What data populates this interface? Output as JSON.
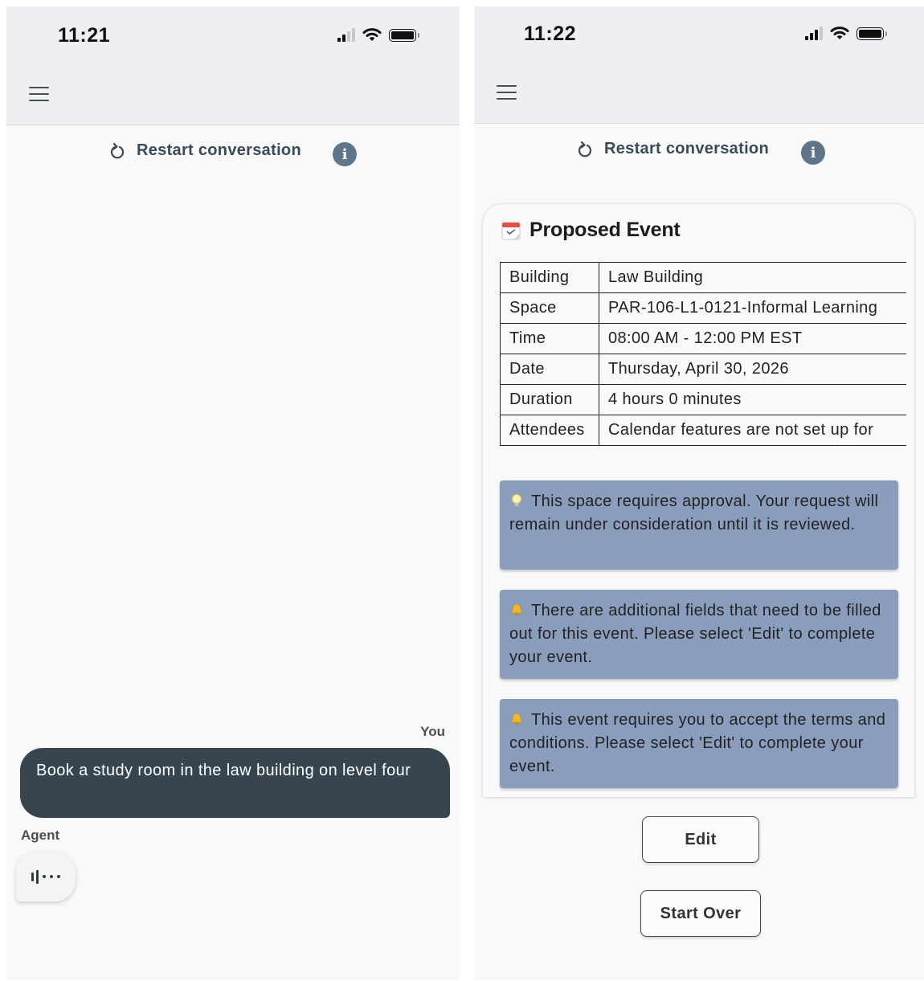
{
  "left_screen": {
    "status_bar": {
      "time": "11:21"
    },
    "restart_label": "Restart conversation",
    "info_glyph": "i",
    "messages": {
      "user_label": "You",
      "user_message": "Book a study room in the law building on level four",
      "agent_label": "Agent"
    },
    "icons": [
      "menu-icon",
      "restart-icon",
      "info-icon",
      "typing-indicator-icon",
      "cellular-signal-icon",
      "wifi-icon",
      "battery-icon"
    ]
  },
  "right_screen": {
    "status_bar": {
      "time": "11:22"
    },
    "restart_label": "Restart conversation",
    "info_glyph": "i",
    "card": {
      "title": "Proposed Event",
      "rows": [
        {
          "label": "Building",
          "value": "Law Building"
        },
        {
          "label": "Space",
          "value": "PAR-106-L1-0121-Informal Learning"
        },
        {
          "label": "Time",
          "value": "08:00 AM - 12:00 PM EST"
        },
        {
          "label": "Date",
          "value": "Thursday, April 30, 2026"
        },
        {
          "label": "Duration",
          "value": "4 hours 0 minutes"
        },
        {
          "label": "Attendees",
          "value": "Calendar features are not set up for"
        }
      ],
      "notices": [
        {
          "icon": "lightbulb-icon",
          "text": "This space requires approval. Your request will remain under consideration until it is reviewed."
        },
        {
          "icon": "bell-icon",
          "text": "There are additional fields that need to be filled out for this event. Please select 'Edit' to complete your event."
        },
        {
          "icon": "bell-icon",
          "text": "This event requires you to accept the terms and conditions. Please select 'Edit' to complete your event."
        }
      ]
    },
    "buttons": {
      "edit": "Edit",
      "start_over": "Start Over"
    }
  },
  "colors": {
    "header_bg": "#eeeff3",
    "user_bubble": "#374551",
    "notice_bg": "#8a9dbd",
    "info_icon": "#5f7688",
    "page_bg": "#f9f9f9"
  }
}
